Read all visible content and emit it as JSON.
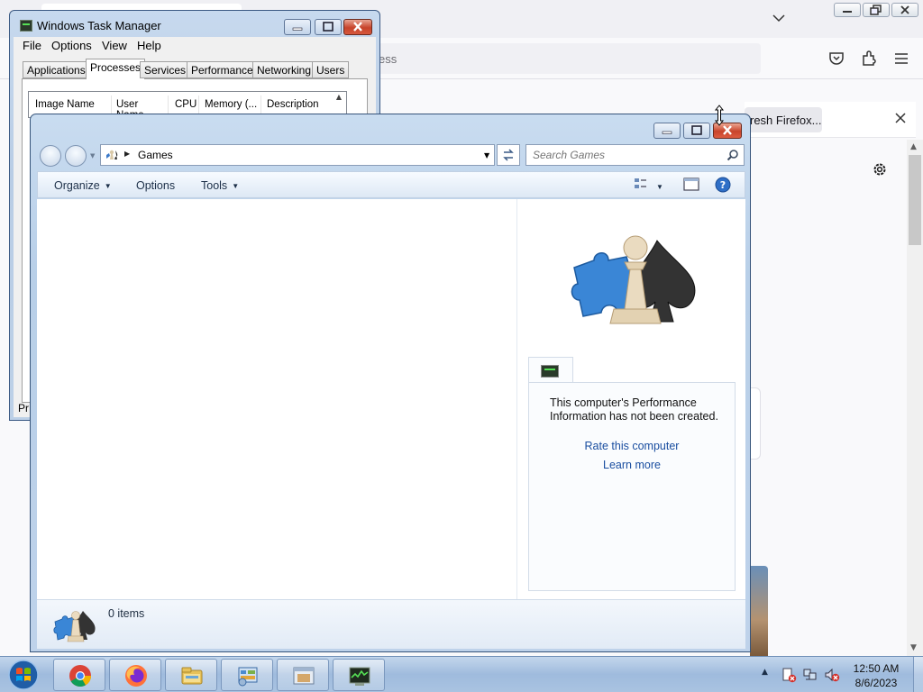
{
  "firefox": {
    "url_text": "ess",
    "notice_text": "resh Firefox..."
  },
  "task_manager": {
    "title": "Windows Task Manager",
    "menu": [
      "File",
      "Options",
      "View",
      "Help"
    ],
    "tabs": [
      "Applications",
      "Processes",
      "Services",
      "Performance",
      "Networking",
      "Users"
    ],
    "active_tab": "Processes",
    "columns": [
      "Image Name",
      "User Name",
      "CPU",
      "Memory (...",
      "Description"
    ],
    "status_fragment": "Pr"
  },
  "games": {
    "address": "Games",
    "search_placeholder": "Search Games",
    "commands": {
      "organize": "Organize",
      "options": "Options",
      "tools": "Tools"
    },
    "perf_message": "This computer's Performance Information has not been created.",
    "rate_link": "Rate this computer",
    "learn_link": "Learn more",
    "item_count": "0 items"
  },
  "taskbar": {
    "pinned": [
      "chrome-icon",
      "firefox-icon",
      "explorer-icon",
      "control-panel-icon",
      "games-explorer-icon",
      "task-manager-icon"
    ],
    "time": "12:50 AM",
    "date": "8/6/2023"
  }
}
